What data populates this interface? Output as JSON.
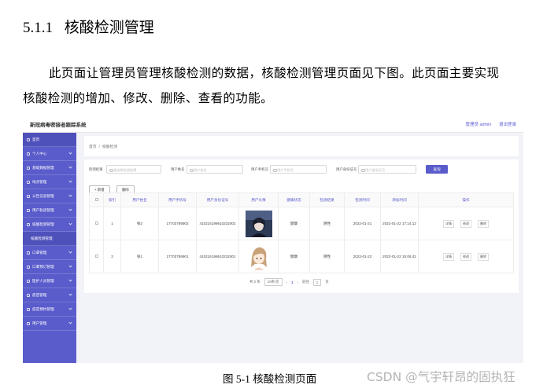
{
  "section": {
    "number": "5.1.1",
    "title": "核酸检测管理"
  },
  "paragraph": {
    "line1": "此页面让管理员管理核酸检测的数据，核酸检测管理页面见下图。此页面主要实现",
    "line2": "核酸检测的增加、修改、删除、查看的功能。"
  },
  "app": {
    "system_title": "新冠病毒密接者跟踪系统",
    "admin_label": "管理员 admin",
    "logout_label": "退出登录",
    "sidebar": {
      "items": [
        "首页",
        "个人中心",
        "基础数据管理",
        "地点管理",
        "公告信息管理",
        "用户轨迹管理",
        "核酸检测管理",
        "核酸检测管理",
        "口罩管理",
        "口罩预订管理",
        "医护人员管理",
        "疫苗管理",
        "疫苗预约管理",
        "用户管理"
      ]
    },
    "breadcrumb": {
      "home": "首页",
      "separator": "/",
      "current": "核酸检测"
    },
    "search": {
      "label1": "检测结果",
      "placeholder1": "请选择检测结果",
      "label2": "用户姓名",
      "placeholder2": "用户姓名",
      "label3": "用户手机号",
      "placeholder3": "用户手机号",
      "label4": "用户身份证号",
      "placeholder4": "用户身份证号",
      "button": "查询"
    },
    "actions": {
      "add": "+ 新增",
      "delete": "删除"
    },
    "table": {
      "headers": [
        "",
        "索引",
        "用户姓名",
        "用户手机号",
        "用户身份证号",
        "用户头像",
        "健康状态",
        "检测结果",
        "检测时间",
        "添加时间",
        "操作"
      ],
      "rows": [
        {
          "index": "1",
          "name": "张2",
          "phone": "17703786902",
          "id_number": "410224199610232002",
          "health": "健康",
          "result": "阴性",
          "test_time": "2022-01-21",
          "add_time": "2022-01-22 17:14:12"
        },
        {
          "index": "2",
          "name": "张1",
          "phone": "17703786901",
          "id_number": "410224199610232001",
          "health": "健康",
          "result": "阴性",
          "test_time": "2022-01-22",
          "add_time": "2022-01-22 15:06:42"
        }
      ],
      "ops": {
        "detail": "详情",
        "edit": "修改",
        "delete": "删除"
      }
    },
    "pager": {
      "total": "共 2 条",
      "per_page": "10条/页",
      "page": "1",
      "goto": "前往",
      "goto_value": "1",
      "page_unit": "页"
    }
  },
  "caption": "图 5-1  核酸检测页面",
  "watermark": "CSDN @气宇轩昂的固执狂",
  "colors": {
    "accent": "#5a5ccb",
    "sidebar": "#5a5ccb",
    "watermark": "#b4b4b4"
  }
}
